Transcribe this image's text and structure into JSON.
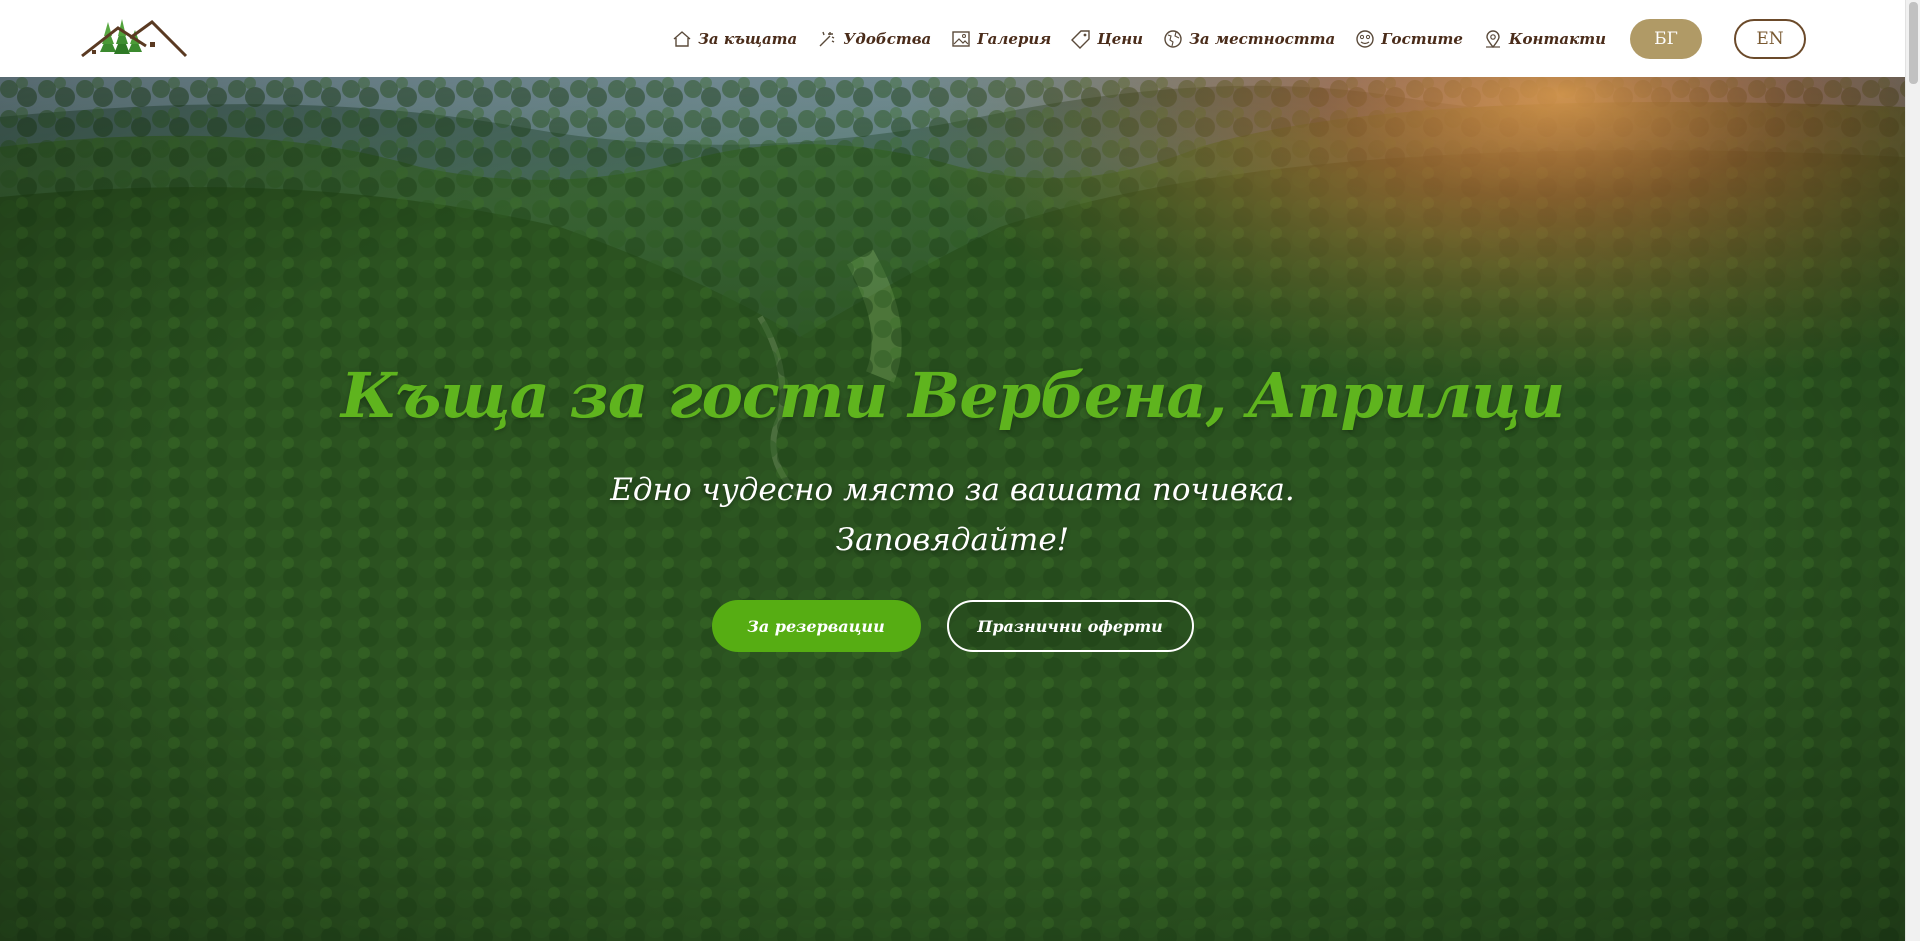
{
  "header": {
    "nav": [
      {
        "label": "За къщата",
        "icon": "house-icon"
      },
      {
        "label": "Удобства",
        "icon": "magic-wand-icon"
      },
      {
        "label": "Галерия",
        "icon": "image-icon"
      },
      {
        "label": "Цени",
        "icon": "price-tag-icon"
      },
      {
        "label": "За местността",
        "icon": "globe-icon"
      },
      {
        "label": "Гостите",
        "icon": "smiley-icon"
      },
      {
        "label": "Контакти",
        "icon": "map-pin-icon"
      }
    ],
    "lang_bg": "БГ",
    "lang_en": "EN"
  },
  "hero": {
    "title": "Къща за гости Вербена, Априлци",
    "subtitle_line1": "Едно чудесно място за вашата почивка.",
    "subtitle_line2": "Заповядайте!",
    "btn_reservations": "За резервации",
    "btn_offers": "Празнични оферти"
  },
  "colors": {
    "accent_green": "#56ad13",
    "title_green": "#5fb41e",
    "nav_brown": "#4a2c1a",
    "lang_active": "#b09a66"
  }
}
